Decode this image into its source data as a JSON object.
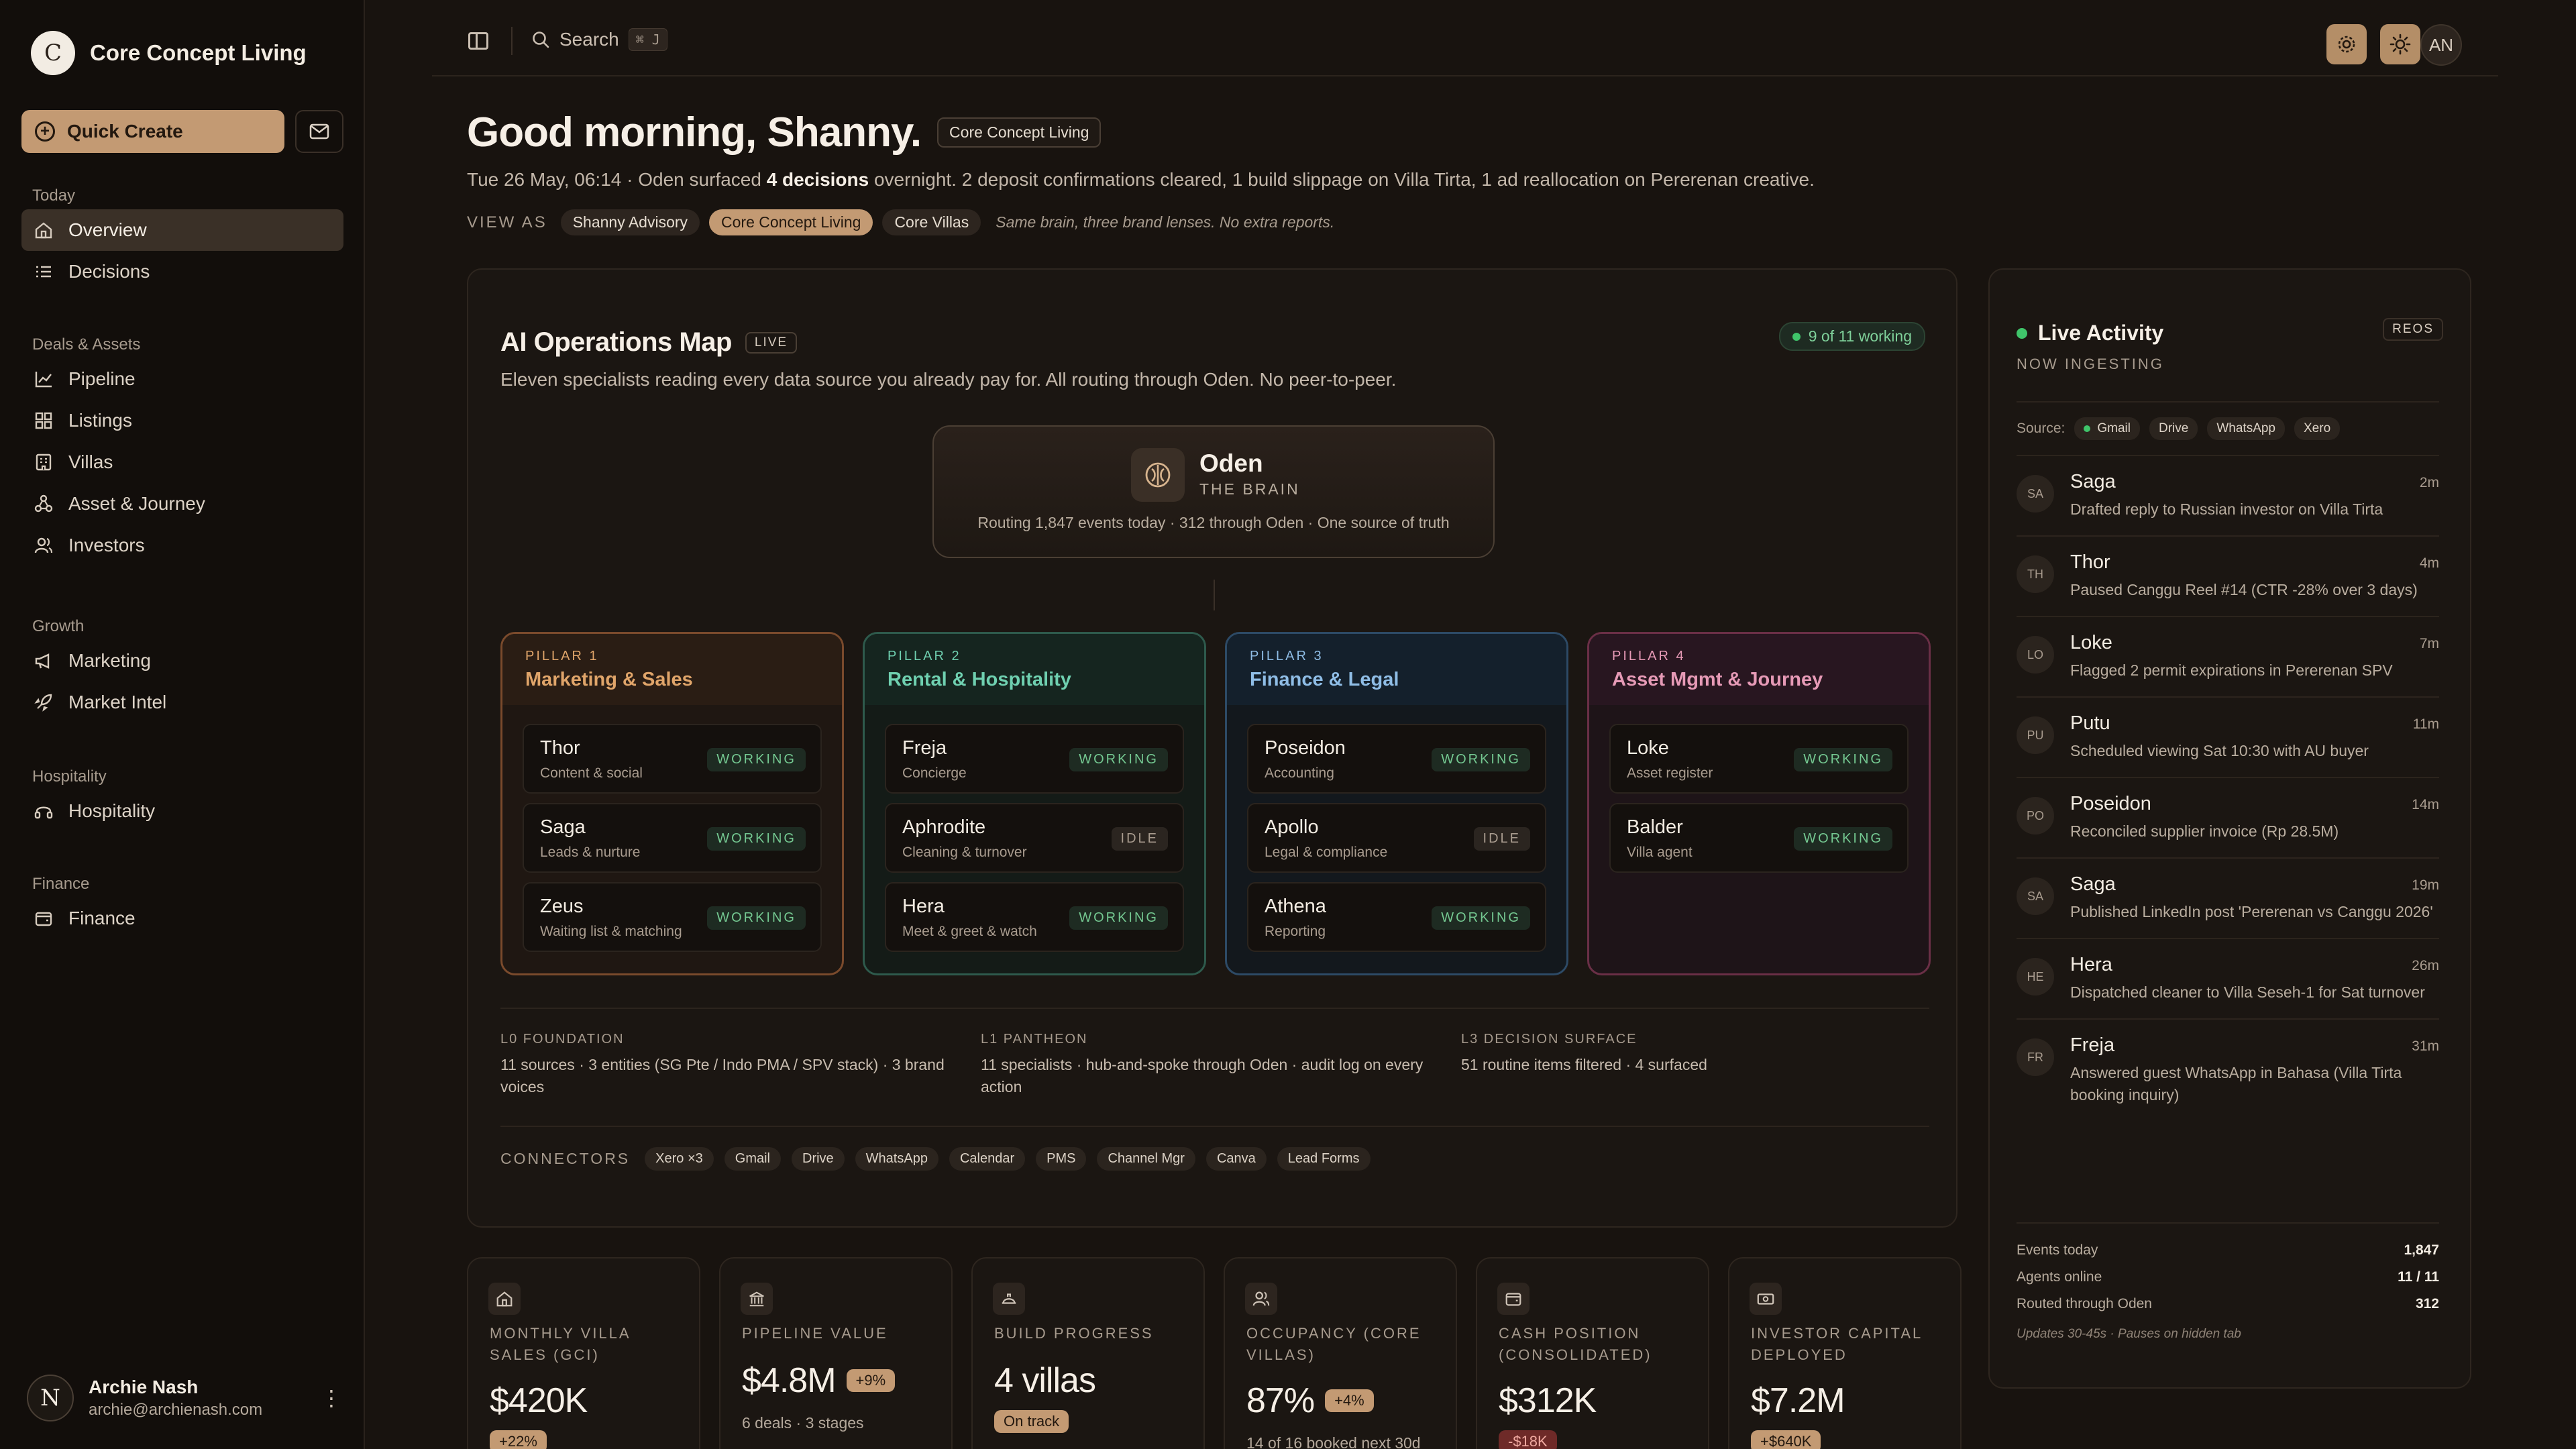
{
  "brand": {
    "initial": "C",
    "name": "Core Concept Living"
  },
  "quick_create": "Quick Create",
  "nav": {
    "groups": [
      {
        "title": "Today",
        "items": [
          {
            "label": "Overview",
            "icon": "home-icon",
            "active": true
          },
          {
            "label": "Decisions",
            "icon": "list-icon"
          }
        ]
      },
      {
        "title": "Deals & Assets",
        "items": [
          {
            "label": "Pipeline",
            "icon": "chart-line-icon"
          },
          {
            "label": "Listings",
            "icon": "grid-icon"
          },
          {
            "label": "Villas",
            "icon": "building-icon"
          },
          {
            "label": "Asset & Journey",
            "icon": "nodes-icon"
          },
          {
            "label": "Investors",
            "icon": "users-icon"
          }
        ]
      },
      {
        "title": "Growth",
        "items": [
          {
            "label": "Marketing",
            "icon": "megaphone-icon"
          },
          {
            "label": "Market Intel",
            "icon": "rocket-icon"
          }
        ]
      },
      {
        "title": "Hospitality",
        "items": [
          {
            "label": "Hospitality",
            "icon": "headset-icon"
          }
        ]
      },
      {
        "title": "Finance",
        "items": [
          {
            "label": "Finance",
            "icon": "wallet-icon"
          }
        ]
      }
    ]
  },
  "user": {
    "initial": "N",
    "name": "Archie Nash",
    "email": "archie@archienash.com"
  },
  "topbar": {
    "search": "Search",
    "shortcut": "⌘ J",
    "avatar": "AN"
  },
  "greeting": {
    "title": "Good morning, Shanny.",
    "org_chip": "Core Concept Living",
    "summary_pre": "Tue 26 May, 06:14 · Oden surfaced ",
    "summary_bold": "4 decisions",
    "summary_post": " overnight. 2 deposit confirmations cleared, 1 build slippage on Villa Tirta, 1 ad reallocation on Pererenan creative.",
    "view_as_label": "VIEW AS",
    "lenses": [
      "Shanny Advisory",
      "Core Concept Living",
      "Core Villas"
    ],
    "lens_selected": 1,
    "note": "Same brain, three brand lenses. No extra reports."
  },
  "ops_map": {
    "title": "AI Operations Map",
    "live": "LIVE",
    "subtitle": "Eleven specialists reading every data source you already pay for. All routing through Oden. No peer-to-peer.",
    "working_status": "9 of 11 working",
    "brain": {
      "name": "Oden",
      "tag": "THE BRAIN",
      "desc": "Routing 1,847 events today · 312 through Oden · One source of truth"
    },
    "pillars": [
      {
        "num": "PILLAR 1",
        "name": "Marketing & Sales",
        "accent": "#e0a56a",
        "border": "#7a4a2c",
        "head": "#2a1d14",
        "body": "#1f1712",
        "agents": [
          {
            "name": "Thor",
            "role": "Content & social",
            "status": "WORKING"
          },
          {
            "name": "Saga",
            "role": "Leads & nurture",
            "status": "WORKING"
          },
          {
            "name": "Zeus",
            "role": "Waiting list & matching",
            "status": "WORKING"
          }
        ]
      },
      {
        "num": "PILLAR 2",
        "name": "Rental & Hospitality",
        "accent": "#6fd0b0",
        "border": "#2e5a4c",
        "head": "#15251f",
        "body": "#141b17",
        "agents": [
          {
            "name": "Freja",
            "role": "Concierge",
            "status": "WORKING"
          },
          {
            "name": "Aphrodite",
            "role": "Cleaning & turnover",
            "status": "IDLE"
          },
          {
            "name": "Hera",
            "role": "Meet & greet & watch",
            "status": "WORKING"
          }
        ]
      },
      {
        "num": "PILLAR 3",
        "name": "Finance & Legal",
        "accent": "#8fbde6",
        "border": "#2d4a66",
        "head": "#14202c",
        "body": "#13181d",
        "agents": [
          {
            "name": "Poseidon",
            "role": "Accounting",
            "status": "WORKING"
          },
          {
            "name": "Apollo",
            "role": "Legal & compliance",
            "status": "IDLE"
          },
          {
            "name": "Athena",
            "role": "Reporting",
            "status": "WORKING"
          }
        ]
      },
      {
        "num": "PILLAR 4",
        "name": "Asset Mgmt & Journey",
        "accent": "#e69ab6",
        "border": "#6a2f46",
        "head": "#281620",
        "body": "#1e1418",
        "agents": [
          {
            "name": "Loke",
            "role": "Asset register",
            "status": "WORKING"
          },
          {
            "name": "Balder",
            "role": "Villa agent",
            "status": "WORKING"
          }
        ]
      }
    ],
    "layers": [
      {
        "key": "L0 FOUNDATION",
        "value": "11 sources · 3 entities (SG Pte / Indo PMA / SPV stack) · 3 brand voices"
      },
      {
        "key": "L1 PANTHEON",
        "value": "11 specialists · hub-and-spoke through Oden · audit log on every action"
      },
      {
        "key": "L3 DECISION SURFACE",
        "value": "51 routine items filtered · 4 surfaced"
      }
    ],
    "connectors_label": "CONNECTORS",
    "connectors": [
      "Xero ×3",
      "Gmail",
      "Drive",
      "WhatsApp",
      "Calendar",
      "PMS",
      "Channel Mgr",
      "Canva",
      "Lead Forms"
    ]
  },
  "kpis": [
    {
      "icon": "home-icon",
      "label": "MONTHLY VILLA SALES (GCI)",
      "value": "$420K",
      "delta": "+22%",
      "delta_type": "pos",
      "sub": "",
      "delta_below": true
    },
    {
      "icon": "bank-icon",
      "label": "PIPELINE VALUE",
      "value": "$4.8M",
      "delta": "+9%",
      "delta_type": "pos",
      "sub": "6 deals · 3 stages",
      "delta_below": false
    },
    {
      "icon": "hardhat-icon",
      "label": "BUILD PROGRESS",
      "value": "4 villas",
      "delta": "On track",
      "delta_type": "pos",
      "sub": "",
      "delta_below": true
    },
    {
      "icon": "users-icon",
      "label": "OCCUPANCY (CORE VILLAS)",
      "value": "87%",
      "delta": "+4%",
      "delta_type": "pos",
      "sub": "14 of 16 booked next 30d",
      "delta_below": false
    },
    {
      "icon": "wallet-icon",
      "label": "CASH POSITION (CONSOLIDATED)",
      "value": "$312K",
      "delta": "-$18K",
      "delta_type": "neg",
      "sub": "",
      "delta_below": true
    },
    {
      "icon": "cash-icon",
      "label": "INVESTOR CAPITAL DEPLOYED",
      "value": "$7.2M",
      "delta": "+$640K",
      "delta_type": "pos",
      "sub": "",
      "delta_below": true
    }
  ],
  "activity": {
    "title": "Live Activity",
    "chip": "REOS",
    "ingesting": "NOW INGESTING",
    "source_label": "Source:",
    "sources": [
      "Gmail",
      "Drive",
      "WhatsApp",
      "Xero"
    ],
    "items": [
      {
        "initials": "SA",
        "name": "Saga",
        "time": "2m",
        "desc": "Drafted reply to Russian investor on Villa Tirta"
      },
      {
        "initials": "TH",
        "name": "Thor",
        "time": "4m",
        "desc": "Paused Canggu Reel #14 (CTR -28% over 3 days)"
      },
      {
        "initials": "LO",
        "name": "Loke",
        "time": "7m",
        "desc": "Flagged 2 permit expirations in Pererenan SPV"
      },
      {
        "initials": "PU",
        "name": "Putu",
        "time": "11m",
        "desc": "Scheduled viewing Sat 10:30 with AU buyer"
      },
      {
        "initials": "PO",
        "name": "Poseidon",
        "time": "14m",
        "desc": "Reconciled supplier invoice (Rp 28.5M)"
      },
      {
        "initials": "SA",
        "name": "Saga",
        "time": "19m",
        "desc": "Published LinkedIn post 'Pererenan vs Canggu 2026'"
      },
      {
        "initials": "HE",
        "name": "Hera",
        "time": "26m",
        "desc": "Dispatched cleaner to Villa Seseh-1 for Sat turnover"
      },
      {
        "initials": "FR",
        "name": "Freja",
        "time": "31m",
        "desc": "Answered guest WhatsApp in Bahasa (Villa Tirta booking inquiry)"
      }
    ],
    "stats": [
      {
        "label": "Events today",
        "value": "1,847"
      },
      {
        "label": "Agents online",
        "value": "11 / 11"
      },
      {
        "label": "Routed through Oden",
        "value": "312"
      }
    ],
    "note": "Updates 30-45s · Pauses on hidden tab"
  }
}
